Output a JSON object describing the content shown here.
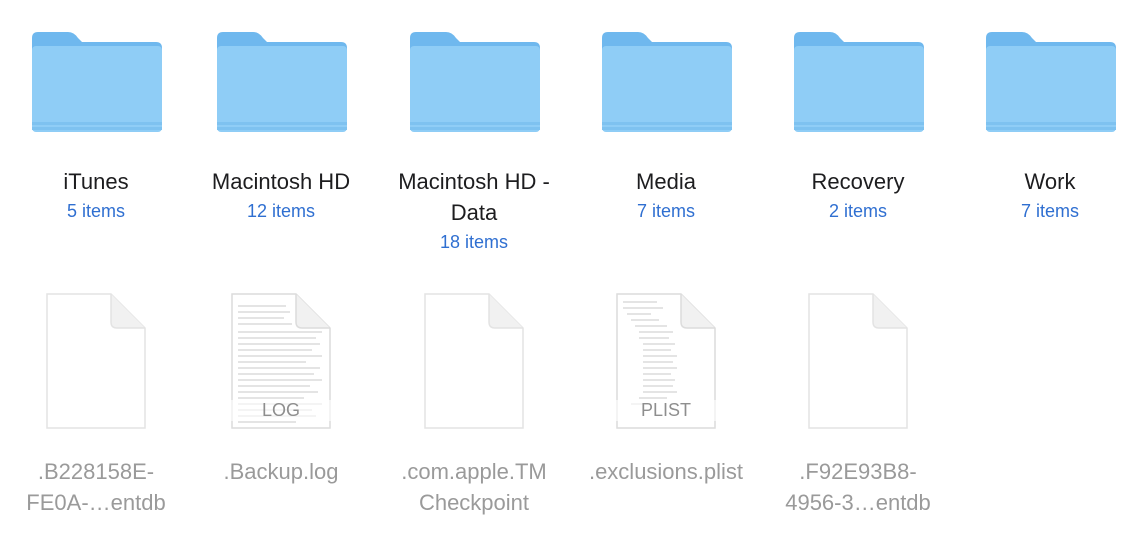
{
  "folders": [
    {
      "name": "iTunes",
      "count": "5 items",
      "icon": "folder-icon"
    },
    {
      "name": "Macintosh HD",
      "count": "12 items",
      "icon": "folder-icon"
    },
    {
      "name": "Macintosh HD - Data",
      "count": "18 items",
      "icon": "folder-icon"
    },
    {
      "name": "Media",
      "count": "7 items",
      "icon": "folder-icon"
    },
    {
      "name": "Recovery",
      "count": "2 items",
      "icon": "folder-icon"
    },
    {
      "name": "Work",
      "count": "7 items",
      "icon": "folder-icon"
    }
  ],
  "files": [
    {
      "name": ".B228158E-FE0A-…entdb",
      "icon": "blank-document-icon",
      "badge": ""
    },
    {
      "name": ".Backup.log",
      "icon": "log-document-icon",
      "badge": "LOG"
    },
    {
      "name": ".com.apple.TMCheckpoint",
      "icon": "blank-document-icon",
      "badge": ""
    },
    {
      "name": ".exclusions.plist",
      "icon": "plist-document-icon",
      "badge": "PLIST"
    },
    {
      "name": ".F92E93B8-4956-3…entdb",
      "icon": "blank-document-icon",
      "badge": ""
    }
  ],
  "colors": {
    "folder_front": "#8fcdf6",
    "folder_back": "#6fb8ee",
    "item_count": "#2f6fd1",
    "file_name": "#9a9a9a"
  }
}
